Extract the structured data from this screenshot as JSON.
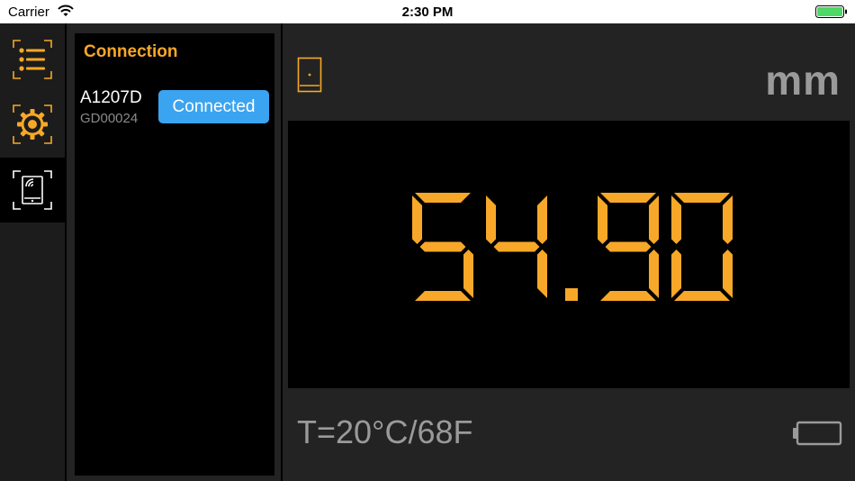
{
  "status_bar": {
    "carrier": "Carrier",
    "time": "2:30 PM"
  },
  "nav": {
    "items": [
      {
        "name": "list",
        "icon": "list-icon",
        "active": false
      },
      {
        "name": "settings",
        "icon": "gear-icon",
        "active": false
      },
      {
        "name": "connection",
        "icon": "device-wireless-icon",
        "active": true
      }
    ]
  },
  "connection": {
    "title": "Connection",
    "device": {
      "name": "A1207D",
      "serial": "GD00024",
      "status": "Connected"
    }
  },
  "display": {
    "unit": "mm",
    "reading": "54.90",
    "temperature": "T=20°C/68F",
    "probe_icon": "probe-icon",
    "battery_icon": "battery-empty-icon"
  },
  "colors": {
    "accent": "#f7a828",
    "connected": "#3ba4f0",
    "muted": "#9a9a9a"
  }
}
